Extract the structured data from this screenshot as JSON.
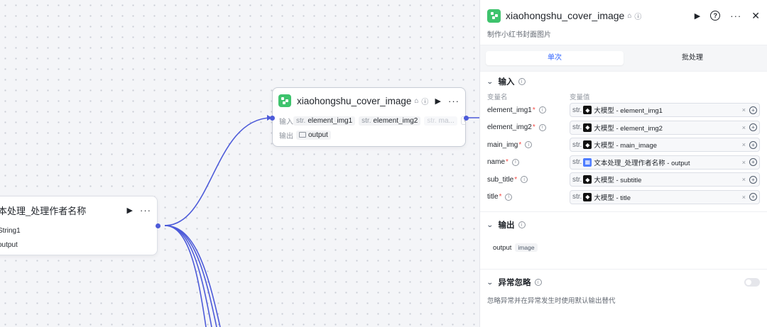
{
  "colors": {
    "accent": "#3366ff",
    "edge": "#4d5bd9",
    "node_icon": "#3ec36d",
    "required": "#f54a45"
  },
  "canvas": {
    "node_main": {
      "title": "xiaohongshu_cover_image",
      "input_label": "输入",
      "output_label": "输出",
      "inputs": [
        {
          "type": "str.",
          "name": "element_img1"
        },
        {
          "type": "str.",
          "name": "element_img2"
        },
        {
          "type": "str.",
          "name": "ma..."
        }
      ],
      "more_inputs": "···",
      "output": "output"
    },
    "node_text": {
      "title": "本处理_处理作者名称",
      "row1": "String1",
      "row2": "output"
    }
  },
  "panel": {
    "title": "xiaohongshu_cover_image",
    "description": "制作小红书封面图片",
    "tabs": [
      {
        "label": "单次",
        "active": true
      },
      {
        "label": "批处理",
        "active": false
      }
    ],
    "inputs_section": {
      "title": "输入",
      "col_name": "变量名",
      "col_value": "变量值",
      "rows": [
        {
          "name": "element_img1",
          "type": "str.",
          "source_icon": "llm-icon",
          "value": "大模型 - element_img1"
        },
        {
          "name": "element_img2",
          "type": "str.",
          "source_icon": "llm-icon",
          "value": "大模型 - element_img2"
        },
        {
          "name": "main_img",
          "type": "str.",
          "source_icon": "llm-icon",
          "value": "大模型 - main_image"
        },
        {
          "name": "name",
          "type": "str.",
          "source_icon": "text-process-icon",
          "value": "文本处理_处理作者名称 - output"
        },
        {
          "name": "sub_title",
          "type": "str.",
          "source_icon": "llm-icon",
          "value": "大模型 - subtitle"
        },
        {
          "name": "title",
          "type": "str.",
          "source_icon": "llm-icon",
          "value": "大模型 - title"
        }
      ],
      "required_mark": "*",
      "clear": "×",
      "add": "+"
    },
    "outputs_section": {
      "title": "输出",
      "name": "output",
      "type": "image"
    },
    "exception_section": {
      "title": "异常忽略",
      "description": "忽略异常并在异常发生时使用默认输出替代",
      "enabled": false
    }
  }
}
